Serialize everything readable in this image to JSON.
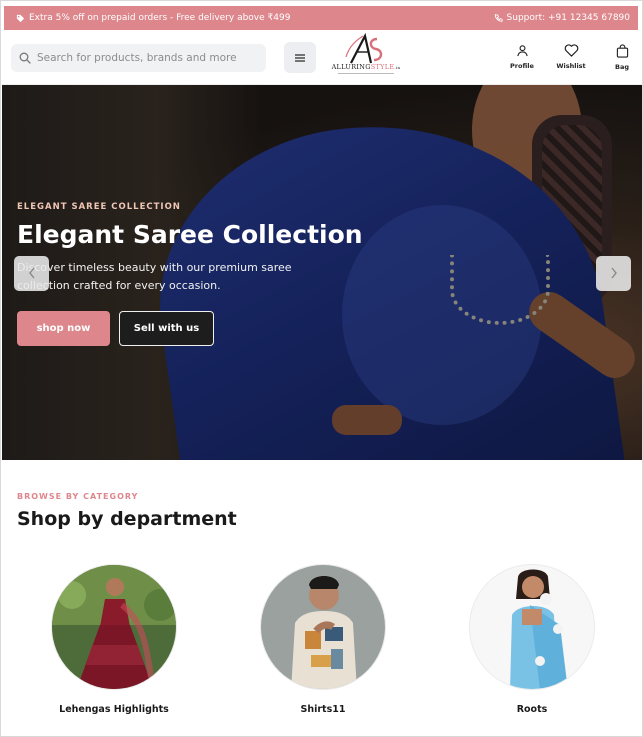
{
  "promo": {
    "offer_text": "Extra 5% off on prepaid orders - Free delivery above ₹499",
    "support_text": "Support: +91 12345 67890"
  },
  "header": {
    "search_placeholder": "Search for products, brands and more",
    "logo_text_a": "ALLURING",
    "logo_text_b": "STYLE",
    "logo_suffix": ".in",
    "actions": {
      "profile": "Profile",
      "wishlist": "Wishlist",
      "bag": "Bag"
    }
  },
  "hero": {
    "eyebrow": "ELEGANT SAREE COLLECTION",
    "title": "Elegant Saree Collection",
    "subtitle": "Discover timeless beauty with our premium saree collection crafted for every occasion.",
    "primary_cta": "shop now",
    "secondary_cta": "Sell with us"
  },
  "categories": {
    "eyebrow": "BROWSE BY CATEGORY",
    "title": "Shop by department",
    "items": [
      {
        "label": "Lehengas Highlights"
      },
      {
        "label": "Shirts11"
      },
      {
        "label": "Roots"
      }
    ]
  },
  "colors": {
    "brand_pink": "#dd878d",
    "saree_blue": "#1d2f7e",
    "text_dark": "#1a1a1a"
  },
  "icons": [
    "tag-icon",
    "phone-icon",
    "search-icon",
    "menu-icon",
    "user-icon",
    "heart-icon",
    "bag-icon",
    "chevron-left-icon",
    "chevron-right-icon"
  ]
}
